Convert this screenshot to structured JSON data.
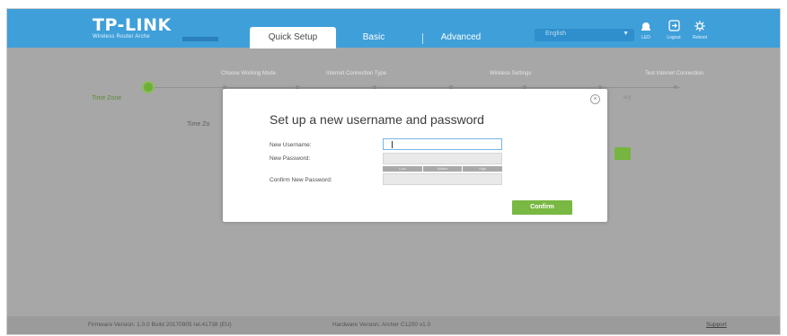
{
  "header": {
    "brand": "TP-LINK",
    "model": "Wireless Router Arche",
    "tabs": [
      "Quick Setup",
      "Basic",
      "Advanced"
    ],
    "language": "English",
    "tools": [
      {
        "label": "LED",
        "icon": "led-icon"
      },
      {
        "label": "Logout",
        "icon": "logout-icon"
      },
      {
        "label": "Reboot",
        "icon": "reboot-icon"
      }
    ]
  },
  "wizard": {
    "steps": [
      "Choose Working Mode",
      "Internet Connection Type",
      "Wireless Settings",
      "Test Internet Connection"
    ],
    "current_step": "Time Zone",
    "field_label": "Time Zo",
    "faded_text": "ery"
  },
  "dialog": {
    "title": "Set up a new username and password",
    "username_label": "New Username:",
    "password_label": "New Password:",
    "confirm_label": "Confirm New Password:",
    "strength": [
      "Low",
      "Middle",
      "High"
    ],
    "confirm_button": "Confirm",
    "close_glyph": "×"
  },
  "footer": {
    "firmware": "Firmware Version: 1.0.0 Build 20170905 rel.41738 (EU)",
    "hardware": "Hardware Version: Archer C1200 v1.0",
    "support": "Support"
  },
  "colors": {
    "header": "#3f9fd9",
    "overlay": "#a7a7a7",
    "accent_green": "#78b843"
  }
}
